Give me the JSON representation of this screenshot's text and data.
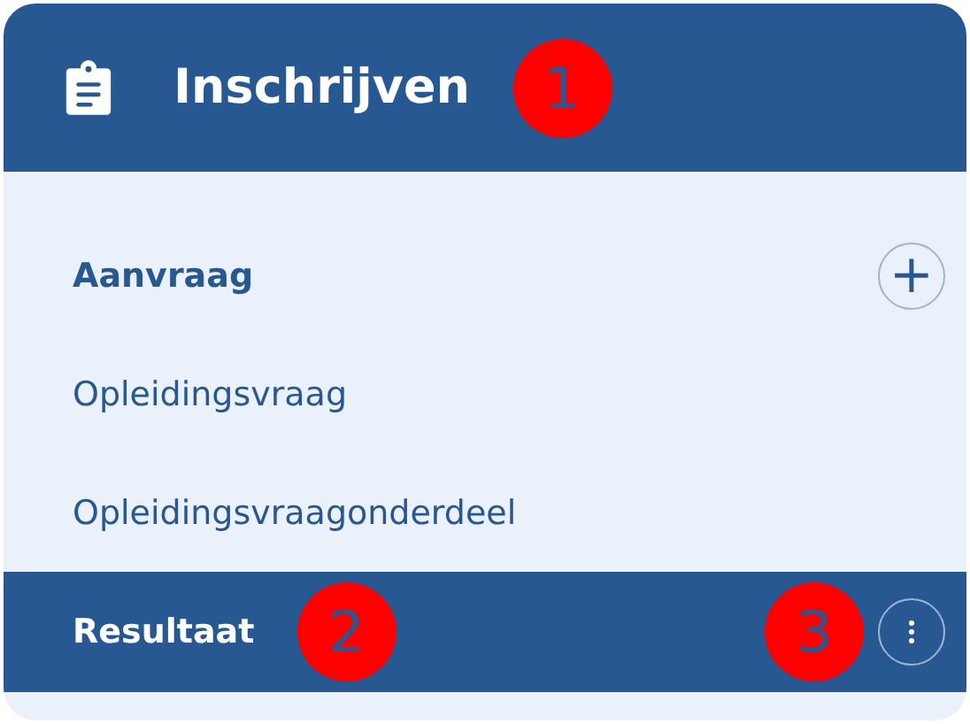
{
  "header": {
    "title": "Inschrijven",
    "callout": "1"
  },
  "items": [
    {
      "label": "Aanvraag",
      "kind": "group",
      "selected": false,
      "addable": true,
      "action_label": "+"
    },
    {
      "label": "Opleidingsvraag",
      "kind": "link",
      "selected": false
    },
    {
      "label": "Opleidingsvraagonderdeel",
      "kind": "link",
      "selected": false
    },
    {
      "label": "Resultaat",
      "kind": "group",
      "selected": true,
      "label_callout": "2",
      "action_callout": "3",
      "has_menu": true
    }
  ]
}
